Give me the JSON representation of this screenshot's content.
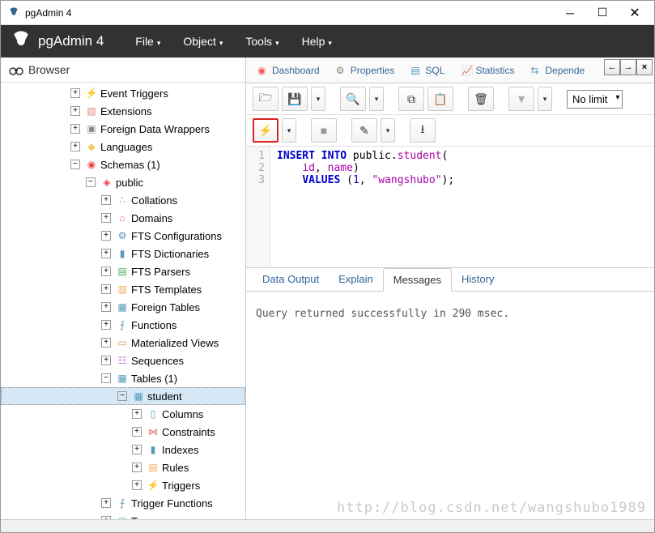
{
  "window": {
    "title": "pgAdmin 4"
  },
  "app": {
    "name": "pgAdmin 4"
  },
  "menus": [
    "File",
    "Object",
    "Tools",
    "Help"
  ],
  "browser": {
    "title": "Browser"
  },
  "tree": {
    "event_triggers": "Event Triggers",
    "extensions": "Extensions",
    "fdw": "Foreign Data Wrappers",
    "languages": "Languages",
    "schemas": "Schemas (1)",
    "public": "public",
    "collations": "Collations",
    "domains": "Domains",
    "fts_conf": "FTS Configurations",
    "fts_dict": "FTS Dictionaries",
    "fts_parsers": "FTS Parsers",
    "fts_templates": "FTS Templates",
    "foreign_tables": "Foreign Tables",
    "functions": "Functions",
    "mat_views": "Materialized Views",
    "sequences": "Sequences",
    "tables": "Tables (1)",
    "student": "student",
    "columns": "Columns",
    "constraints": "Constraints",
    "indexes": "Indexes",
    "rules": "Rules",
    "triggers": "Triggers",
    "trigger_functions": "Trigger Functions",
    "types": "Types"
  },
  "tabs": {
    "dashboard": "Dashboard",
    "properties": "Properties",
    "sql": "SQL",
    "statistics": "Statistics",
    "dependencies": "Depende"
  },
  "toolbar": {
    "limit_label": "No limit"
  },
  "sql": {
    "lines": [
      "1",
      "2",
      "3"
    ],
    "l1_a": "INSERT INTO ",
    "l1_b": "public",
    "l1_c": ".",
    "l1_d": "student",
    "l1_e": "(",
    "l2_a": "id",
    "l2_b": ", ",
    "l2_c": "name",
    "l2_d": ")",
    "l3_a": "VALUES ",
    "l3_b": "(",
    "l3_c": "1",
    "l3_d": ", ",
    "l3_e": "\"wangshubo\"",
    "l3_f": ");"
  },
  "result_tabs": {
    "data_output": "Data Output",
    "explain": "Explain",
    "messages": "Messages",
    "history": "History"
  },
  "messages": {
    "text": "Query returned successfully in 290 msec."
  },
  "watermark": "http://blog.csdn.net/wangshubo1989"
}
